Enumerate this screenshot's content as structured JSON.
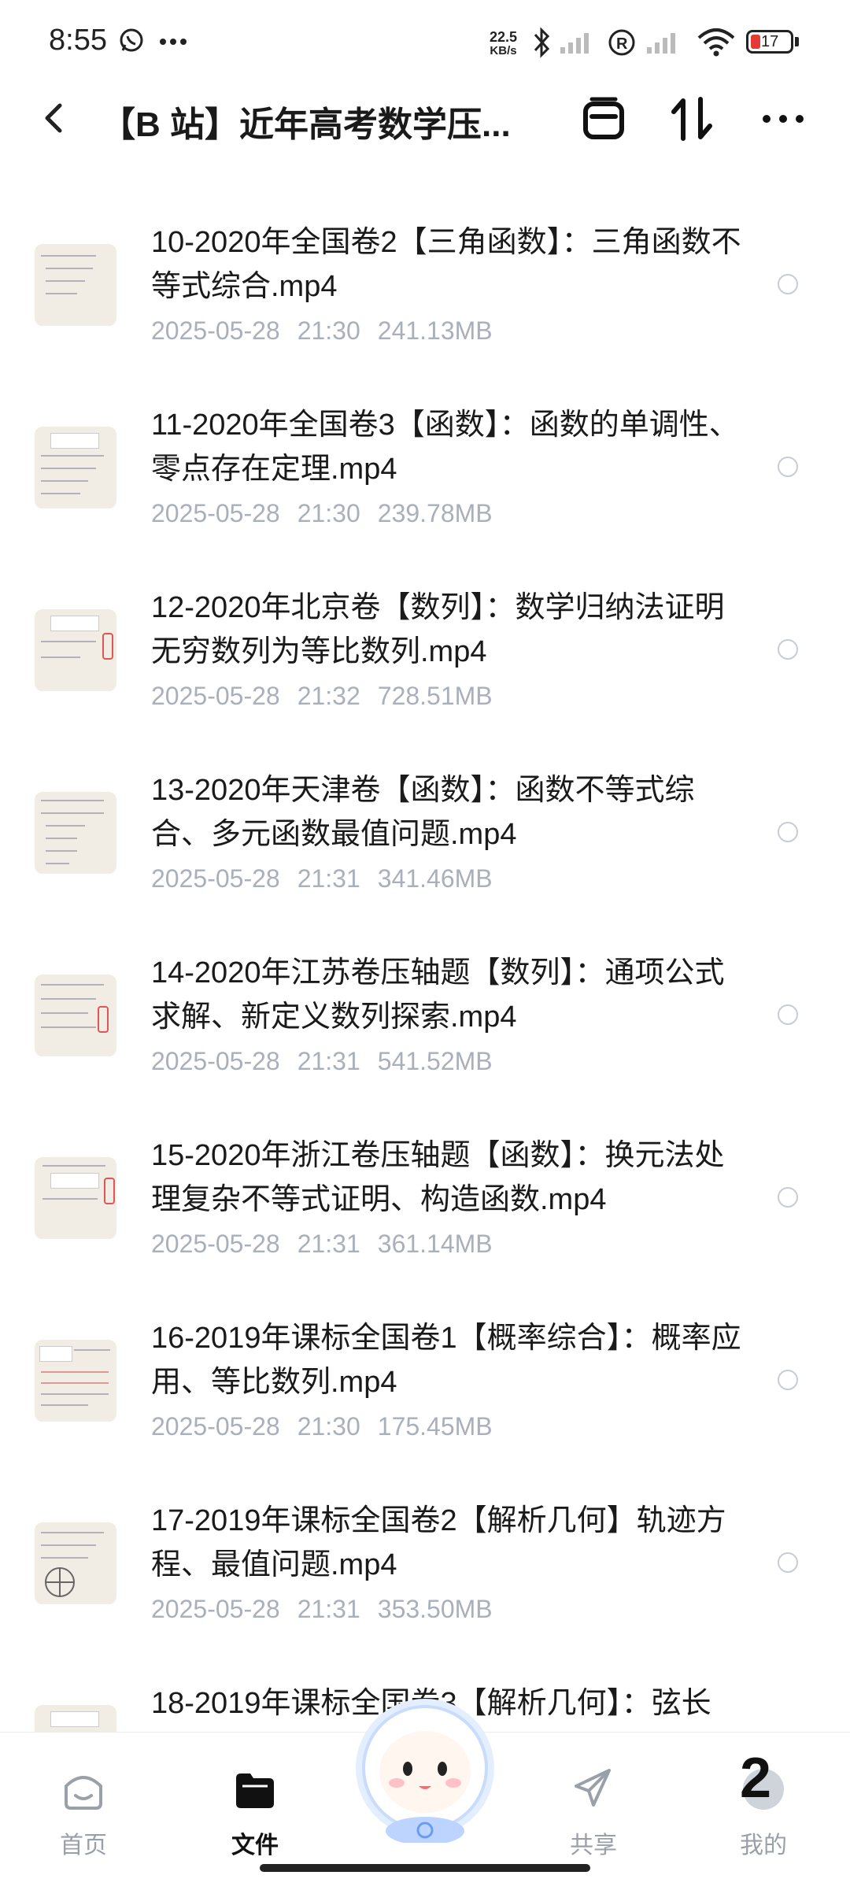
{
  "status_bar": {
    "time": "8:55",
    "net_speed_value": "22.5",
    "net_speed_unit": "KB/s",
    "battery_level": "17",
    "battery_color": "#e53935"
  },
  "header": {
    "title": "【B 站】近年高考数学压...",
    "back_icon": "chevron-left-icon",
    "actions": [
      "select-box-icon",
      "sort-icon",
      "more-icon"
    ]
  },
  "files": [
    {
      "name": "10-2020年全国卷2【三角函数】：三角函数不等式综合.mp4",
      "date": "2025-05-28",
      "time": "21:30",
      "size": "241.13MB"
    },
    {
      "name": "11-2020年全国卷3【函数】：函数的单调性、零点存在定理.mp4",
      "date": "2025-05-28",
      "time": "21:30",
      "size": "239.78MB"
    },
    {
      "name": "12-2020年北京卷【数列】：数学归纳法证明无穷数列为等比数列.mp4",
      "date": "2025-05-28",
      "time": "21:32",
      "size": "728.51MB"
    },
    {
      "name": "13-2020年天津卷【函数】：函数不等式综合、多元函数最值问题.mp4",
      "date": "2025-05-28",
      "time": "21:31",
      "size": "341.46MB"
    },
    {
      "name": "14-2020年江苏卷压轴题【数列】：通项公式求解、新定义数列探索.mp4",
      "date": "2025-05-28",
      "time": "21:31",
      "size": "541.52MB"
    },
    {
      "name": "15-2020年浙江卷压轴题【函数】：换元法处理复杂不等式证明、构造函数.mp4",
      "date": "2025-05-28",
      "time": "21:31",
      "size": "361.14MB"
    },
    {
      "name": "16-2019年课标全国卷1【概率综合】：概率应用、等比数列.mp4",
      "date": "2025-05-28",
      "time": "21:30",
      "size": "175.45MB"
    },
    {
      "name": "17-2019年课标全国卷2【解析几何】轨迹方程、最值问题.mp4",
      "date": "2025-05-28",
      "time": "21:31",
      "size": "353.50MB"
    },
    {
      "name": "18-2019年课标全国卷3【解析几何】：弦长",
      "date": "",
      "time": "",
      "size": ""
    }
  ],
  "bottom_nav": {
    "items": [
      {
        "label": "首页",
        "icon": "home-icon",
        "active": false
      },
      {
        "label": "文件",
        "icon": "folder-icon",
        "active": true
      },
      {
        "label": "共享",
        "icon": "send-icon",
        "active": false
      },
      {
        "label": "我的",
        "icon": "profile-icon",
        "active": false
      }
    ],
    "profile_badge": "2"
  }
}
